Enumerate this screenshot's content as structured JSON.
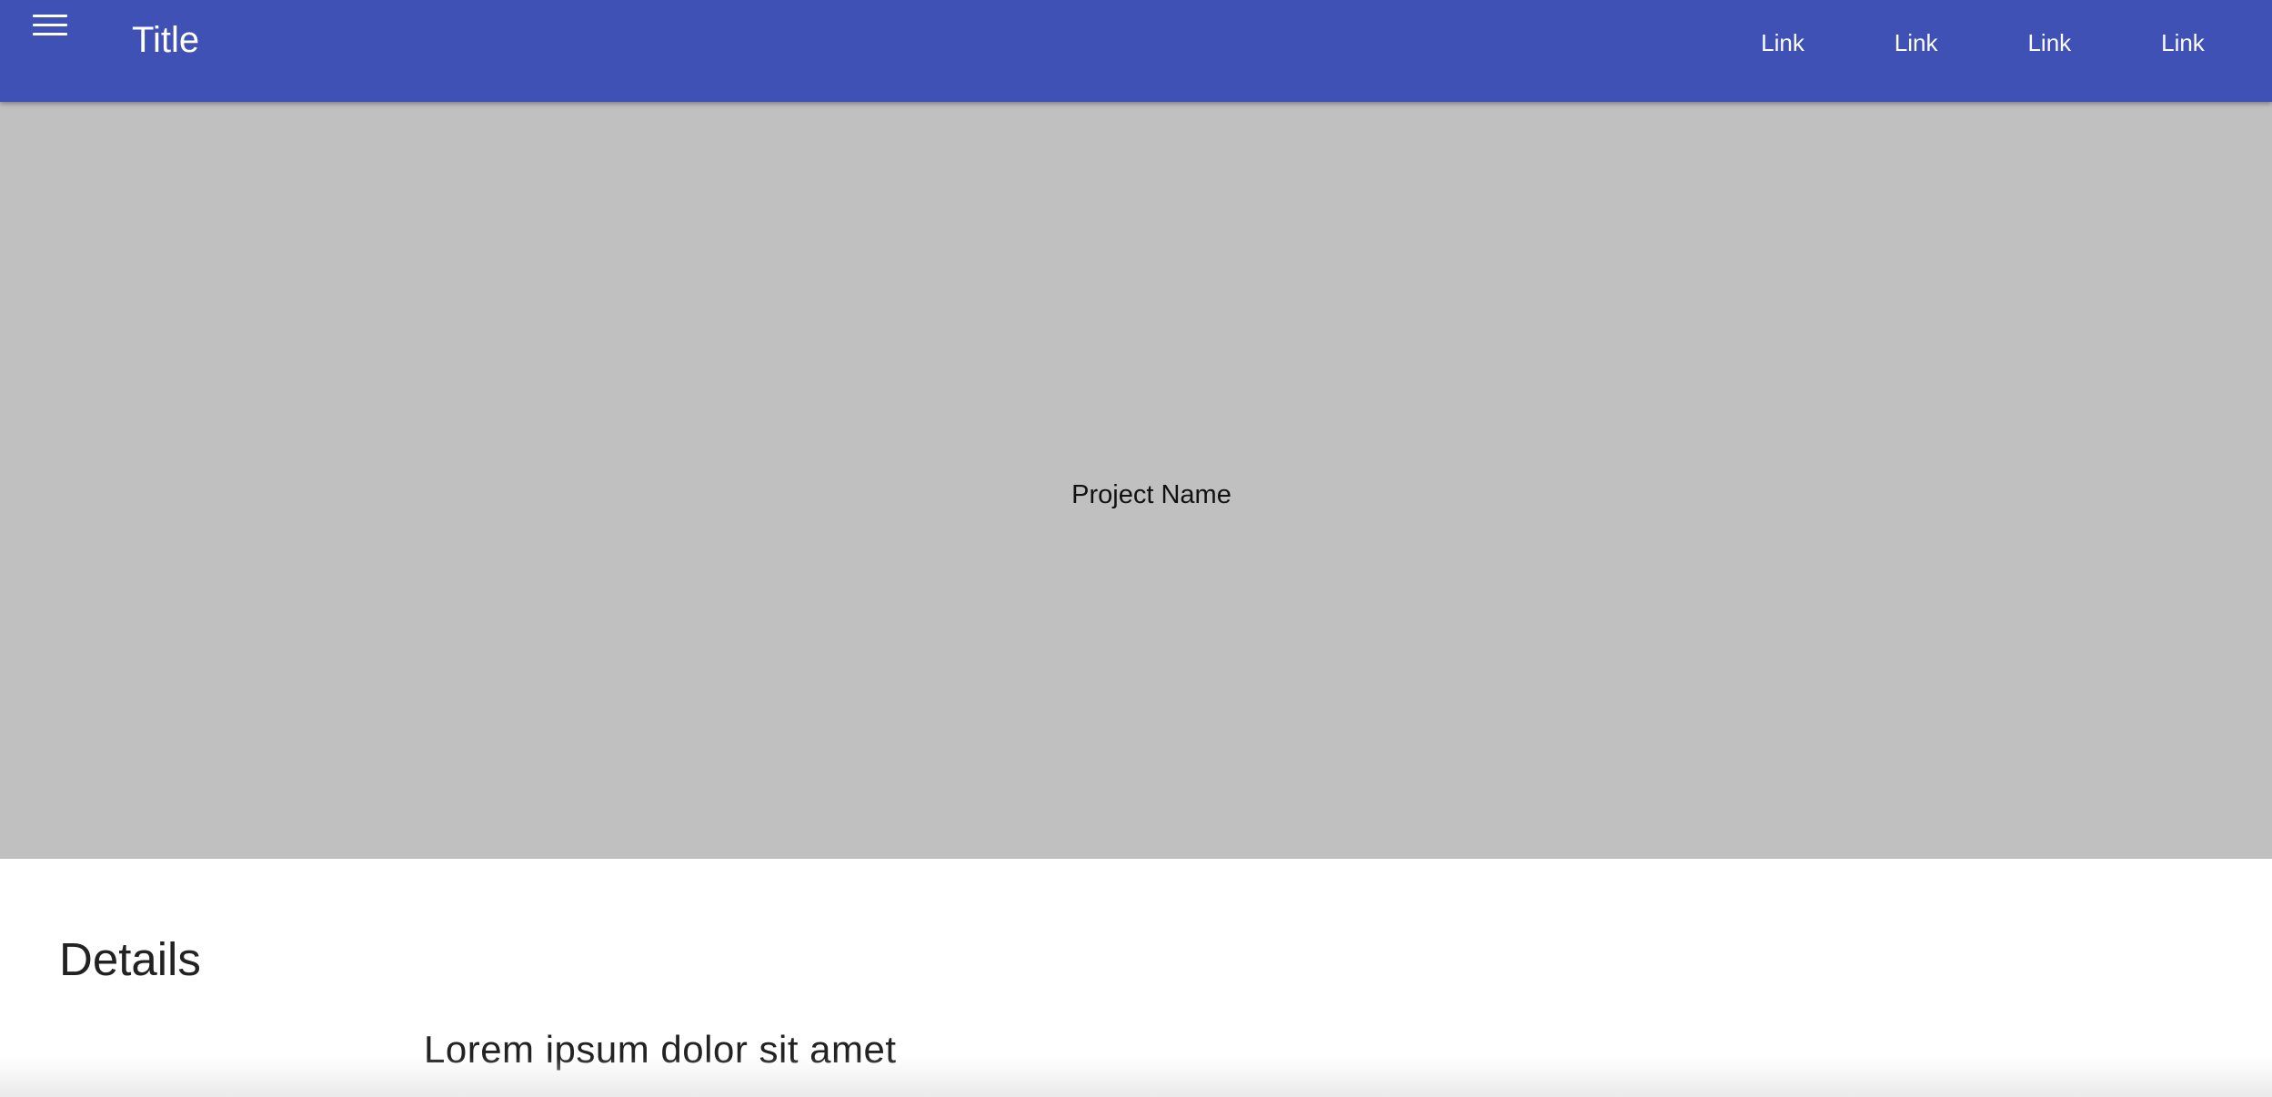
{
  "header": {
    "title": "Title",
    "menu_icon": "hamburger-menu-icon",
    "links": [
      {
        "label": "Link"
      },
      {
        "label": "Link"
      },
      {
        "label": "Link"
      },
      {
        "label": "Link"
      }
    ],
    "background_color": "#3f51b5"
  },
  "hero": {
    "label": "Project Name",
    "background_color": "#c0c0c0"
  },
  "details": {
    "heading": "Details",
    "text": "Lorem ipsum dolor sit amet"
  }
}
